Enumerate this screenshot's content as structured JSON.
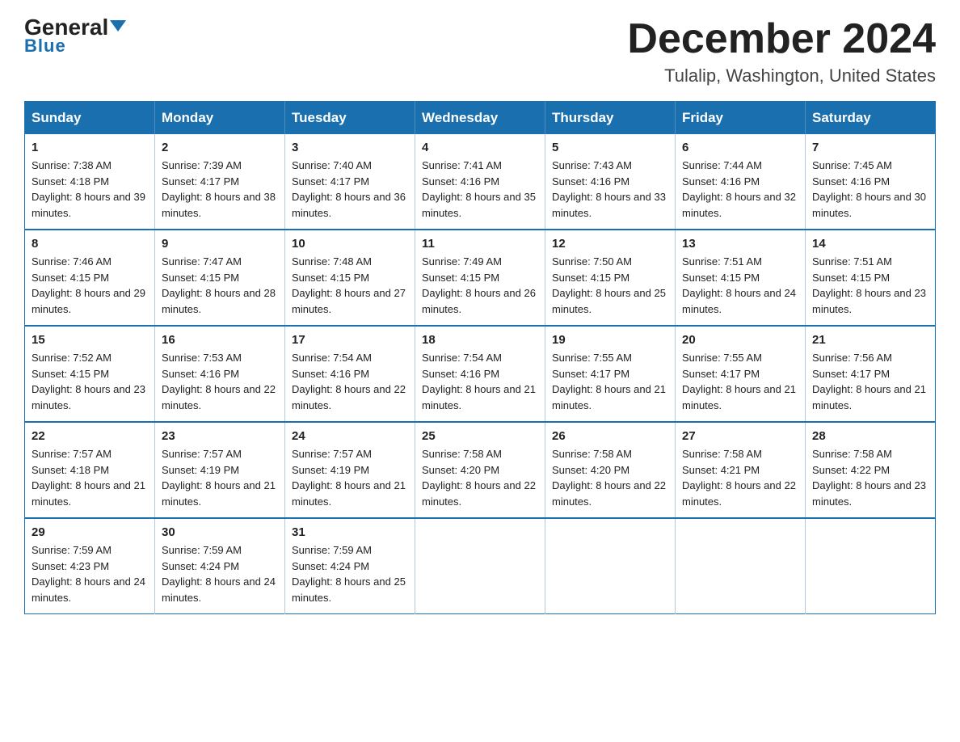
{
  "header": {
    "logo_general": "General",
    "logo_blue": "Blue",
    "title": "December 2024",
    "subtitle": "Tulalip, Washington, United States"
  },
  "days_of_week": [
    "Sunday",
    "Monday",
    "Tuesday",
    "Wednesday",
    "Thursday",
    "Friday",
    "Saturday"
  ],
  "weeks": [
    [
      {
        "day": "1",
        "sunrise": "7:38 AM",
        "sunset": "4:18 PM",
        "daylight": "8 hours and 39 minutes."
      },
      {
        "day": "2",
        "sunrise": "7:39 AM",
        "sunset": "4:17 PM",
        "daylight": "8 hours and 38 minutes."
      },
      {
        "day": "3",
        "sunrise": "7:40 AM",
        "sunset": "4:17 PM",
        "daylight": "8 hours and 36 minutes."
      },
      {
        "day": "4",
        "sunrise": "7:41 AM",
        "sunset": "4:16 PM",
        "daylight": "8 hours and 35 minutes."
      },
      {
        "day": "5",
        "sunrise": "7:43 AM",
        "sunset": "4:16 PM",
        "daylight": "8 hours and 33 minutes."
      },
      {
        "day": "6",
        "sunrise": "7:44 AM",
        "sunset": "4:16 PM",
        "daylight": "8 hours and 32 minutes."
      },
      {
        "day": "7",
        "sunrise": "7:45 AM",
        "sunset": "4:16 PM",
        "daylight": "8 hours and 30 minutes."
      }
    ],
    [
      {
        "day": "8",
        "sunrise": "7:46 AM",
        "sunset": "4:15 PM",
        "daylight": "8 hours and 29 minutes."
      },
      {
        "day": "9",
        "sunrise": "7:47 AM",
        "sunset": "4:15 PM",
        "daylight": "8 hours and 28 minutes."
      },
      {
        "day": "10",
        "sunrise": "7:48 AM",
        "sunset": "4:15 PM",
        "daylight": "8 hours and 27 minutes."
      },
      {
        "day": "11",
        "sunrise": "7:49 AM",
        "sunset": "4:15 PM",
        "daylight": "8 hours and 26 minutes."
      },
      {
        "day": "12",
        "sunrise": "7:50 AM",
        "sunset": "4:15 PM",
        "daylight": "8 hours and 25 minutes."
      },
      {
        "day": "13",
        "sunrise": "7:51 AM",
        "sunset": "4:15 PM",
        "daylight": "8 hours and 24 minutes."
      },
      {
        "day": "14",
        "sunrise": "7:51 AM",
        "sunset": "4:15 PM",
        "daylight": "8 hours and 23 minutes."
      }
    ],
    [
      {
        "day": "15",
        "sunrise": "7:52 AM",
        "sunset": "4:15 PM",
        "daylight": "8 hours and 23 minutes."
      },
      {
        "day": "16",
        "sunrise": "7:53 AM",
        "sunset": "4:16 PM",
        "daylight": "8 hours and 22 minutes."
      },
      {
        "day": "17",
        "sunrise": "7:54 AM",
        "sunset": "4:16 PM",
        "daylight": "8 hours and 22 minutes."
      },
      {
        "day": "18",
        "sunrise": "7:54 AM",
        "sunset": "4:16 PM",
        "daylight": "8 hours and 21 minutes."
      },
      {
        "day": "19",
        "sunrise": "7:55 AM",
        "sunset": "4:17 PM",
        "daylight": "8 hours and 21 minutes."
      },
      {
        "day": "20",
        "sunrise": "7:55 AM",
        "sunset": "4:17 PM",
        "daylight": "8 hours and 21 minutes."
      },
      {
        "day": "21",
        "sunrise": "7:56 AM",
        "sunset": "4:17 PM",
        "daylight": "8 hours and 21 minutes."
      }
    ],
    [
      {
        "day": "22",
        "sunrise": "7:57 AM",
        "sunset": "4:18 PM",
        "daylight": "8 hours and 21 minutes."
      },
      {
        "day": "23",
        "sunrise": "7:57 AM",
        "sunset": "4:19 PM",
        "daylight": "8 hours and 21 minutes."
      },
      {
        "day": "24",
        "sunrise": "7:57 AM",
        "sunset": "4:19 PM",
        "daylight": "8 hours and 21 minutes."
      },
      {
        "day": "25",
        "sunrise": "7:58 AM",
        "sunset": "4:20 PM",
        "daylight": "8 hours and 22 minutes."
      },
      {
        "day": "26",
        "sunrise": "7:58 AM",
        "sunset": "4:20 PM",
        "daylight": "8 hours and 22 minutes."
      },
      {
        "day": "27",
        "sunrise": "7:58 AM",
        "sunset": "4:21 PM",
        "daylight": "8 hours and 22 minutes."
      },
      {
        "day": "28",
        "sunrise": "7:58 AM",
        "sunset": "4:22 PM",
        "daylight": "8 hours and 23 minutes."
      }
    ],
    [
      {
        "day": "29",
        "sunrise": "7:59 AM",
        "sunset": "4:23 PM",
        "daylight": "8 hours and 24 minutes."
      },
      {
        "day": "30",
        "sunrise": "7:59 AM",
        "sunset": "4:24 PM",
        "daylight": "8 hours and 24 minutes."
      },
      {
        "day": "31",
        "sunrise": "7:59 AM",
        "sunset": "4:24 PM",
        "daylight": "8 hours and 25 minutes."
      },
      null,
      null,
      null,
      null
    ]
  ]
}
